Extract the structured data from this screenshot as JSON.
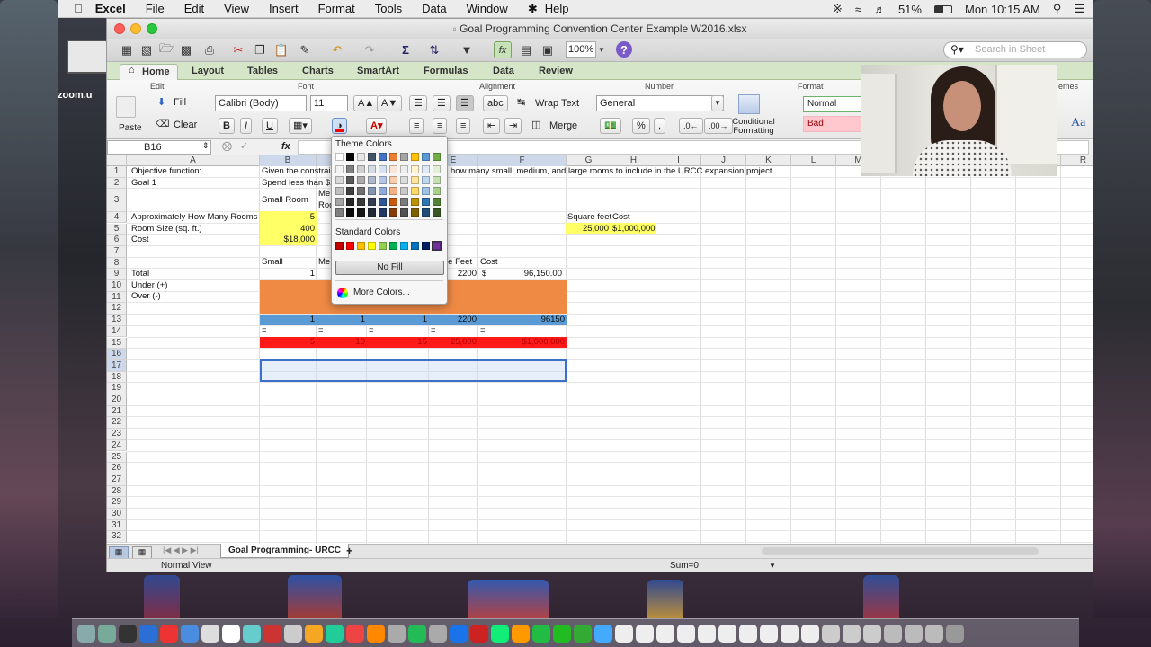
{
  "menubar": {
    "apple": "",
    "app": "Excel",
    "items": [
      "File",
      "Edit",
      "View",
      "Insert",
      "Format",
      "Tools",
      "Data",
      "Window",
      "Help"
    ],
    "battery": "51%",
    "clock": "Mon 10:15 AM"
  },
  "desktop_left_label": "zoom.u",
  "window": {
    "title": "Goal Programming Convention Center Example W2016.xlsx",
    "zoom": "100%",
    "search_placeholder": "Search in Sheet"
  },
  "ribbon": {
    "tabs": [
      "Home",
      "Layout",
      "Tables",
      "Charts",
      "SmartArt",
      "Formulas",
      "Data",
      "Review"
    ],
    "groups": {
      "edit": "Edit",
      "font": "Font",
      "alignment": "Alignment",
      "number": "Number",
      "format": "Format",
      "themes": "emes"
    },
    "paste": "Paste",
    "fill": "Fill",
    "clear": "Clear",
    "font_name": "Calibri (Body)",
    "font_size": "11",
    "bold": "B",
    "italic": "I",
    "underline": "U",
    "wrap_text": "Wrap Text",
    "merge": "Merge",
    "number_format": "General",
    "percent": "%",
    "comma": ",",
    "abc": "abc",
    "conditional_formatting": "Conditional Formatting",
    "style_normal": "Normal",
    "style_bad": "Bad",
    "aa": "Aa"
  },
  "formula_bar": {
    "name_box": "B16",
    "fx": "fx",
    "value": ""
  },
  "palette": {
    "theme_label": "Theme Colors",
    "standard_label": "Standard Colors",
    "no_fill": "No Fill",
    "more_colors": "More Colors...",
    "theme_top": [
      "#ffffff",
      "#000000",
      "#e7e6e6",
      "#44546a",
      "#4472c4",
      "#ed7d31",
      "#a5a5a5",
      "#ffc000",
      "#5b9bd5",
      "#70ad47"
    ],
    "theme_shades": [
      [
        "#f2f2f2",
        "#7f7f7f",
        "#d0cece",
        "#d6dce4",
        "#d9e2f3",
        "#fbe5d5",
        "#ededed",
        "#fff2cc",
        "#deebf6",
        "#e2efd9"
      ],
      [
        "#d8d8d8",
        "#595959",
        "#aeabab",
        "#adb9ca",
        "#b4c6e7",
        "#f7cbac",
        "#dbdbdb",
        "#fee599",
        "#bdd7ee",
        "#c5e0b3"
      ],
      [
        "#bfbfbf",
        "#3f3f3f",
        "#757070",
        "#8496b0",
        "#8eaadb",
        "#f4b183",
        "#c9c9c9",
        "#ffd965",
        "#9dc3e6",
        "#a8d08d"
      ],
      [
        "#a5a5a5",
        "#262626",
        "#3a3838",
        "#323f4f",
        "#2f5496",
        "#c55a11",
        "#7b7b7b",
        "#bf9000",
        "#2e75b5",
        "#538135"
      ],
      [
        "#7f7f7f",
        "#0c0c0c",
        "#171616",
        "#222a35",
        "#1f3864",
        "#833c0b",
        "#525252",
        "#7f6000",
        "#1e4e79",
        "#375623"
      ]
    ],
    "standard": [
      "#c00000",
      "#ff0000",
      "#ffc000",
      "#ffff00",
      "#92d050",
      "#00b050",
      "#00b0f0",
      "#0070c0",
      "#002060",
      "#7030a0"
    ]
  },
  "columns": [
    "A",
    "B",
    "C",
    "D",
    "E",
    "F",
    "G",
    "H",
    "I",
    "J",
    "K",
    "L",
    "M",
    "N",
    "O",
    "P",
    "Q",
    "R"
  ],
  "rows": [
    "1",
    "2",
    "3",
    "4",
    "5",
    "6",
    "7",
    "8",
    "9",
    "10",
    "11",
    "12",
    "13",
    "14",
    "15",
    "16",
    "17",
    "18",
    "19",
    "20",
    "21",
    "22",
    "23",
    "24",
    "25",
    "26",
    "27",
    "28",
    "29",
    "30",
    "31",
    "32"
  ],
  "cells": {
    "a1": "Objective function:",
    "b1": "Given the constrai",
    "b1b": "how many small, medium, and large rooms to include in the URCC expansion project.",
    "a2": "Goal 1",
    "b2": "Spend less than $1",
    "b3": "Small Room",
    "c3a": "Me",
    "c3b": "Roo",
    "a4": "Approximately How Many Rooms",
    "b4": "5",
    "g4": "Square feet",
    "h4": "Cost",
    "a5": "Room Size (sq. ft.)",
    "b5": "400",
    "g5": "25,000",
    "h5": "$1,000,000",
    "a6": "Cost",
    "b6": "$18,000",
    "b8": "Small",
    "c8": "Me",
    "e8": "re Feet",
    "f8": "Cost",
    "a9": "Total",
    "b9": "1",
    "e9": "2200",
    "f9a": "$",
    "f9b": "96,150.00",
    "a10": "Under (+)",
    "a11": "Over (-)",
    "b12": "1",
    "c12": "1",
    "d12": "1",
    "e12": "2200",
    "f12": "96150",
    "b13": "=",
    "c13": "=",
    "d13": "=",
    "e13": "=",
    "f13": "=",
    "b14": "5",
    "c14": "10",
    "d14": "15",
    "e14": "25,000",
    "f14": "$1,000,000"
  },
  "fills": {
    "yellow": "#ffff66",
    "orange": "#ef8a45",
    "blue": "#5b9bd5",
    "red": "#ff1a1a"
  },
  "sheet_tab": "Goal Programming- URCC",
  "status": {
    "view": "Normal View",
    "sum": "Sum=0"
  }
}
